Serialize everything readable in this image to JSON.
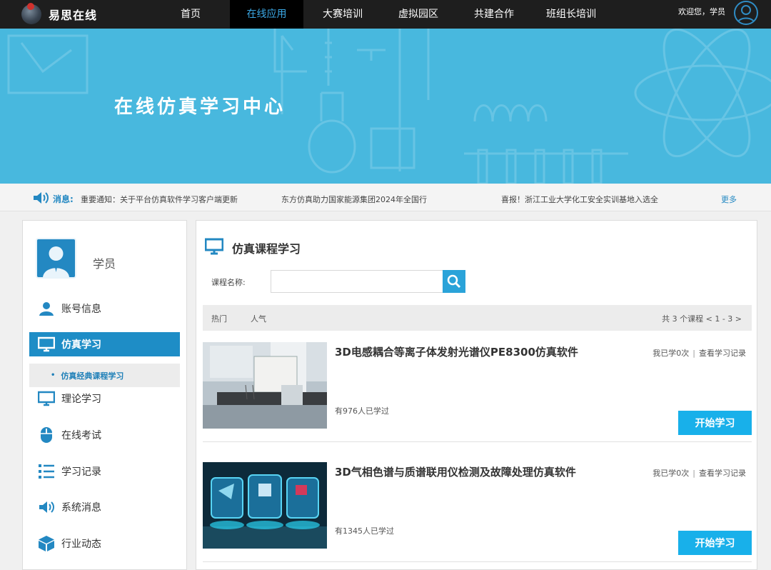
{
  "topbar": {
    "logo_text": "易思在线",
    "nav": [
      {
        "label": "首页",
        "active": false
      },
      {
        "label": "在线应用",
        "active": true
      },
      {
        "label": "大赛培训",
        "active": false
      },
      {
        "label": "虚拟园区",
        "active": false
      },
      {
        "label": "共建合作",
        "active": false
      },
      {
        "label": "班组长培训",
        "active": false
      }
    ],
    "welcome": "欢迎您，学员",
    "user_icon": "user-avatar-icon"
  },
  "banner": {
    "title": "在线仿真学习中心"
  },
  "notice": {
    "label": "消息:",
    "items": [
      "重要通知：关于平台仿真软件学习客户端更新",
      "东方仿真助力国家能源集团2024年全国行",
      "喜报！浙江工业大学化工安全实训基地入选全"
    ],
    "more": "更多"
  },
  "sidebar": {
    "user_name": "学员",
    "menu": [
      {
        "label": "账号信息",
        "icon": "user-icon",
        "active": false
      },
      {
        "label": "仿真学习",
        "icon": "monitor-icon",
        "active": true
      },
      {
        "label": "理论学习",
        "icon": "monitor-icon",
        "active": false
      },
      {
        "label": "在线考试",
        "icon": "mouse-icon",
        "active": false
      },
      {
        "label": "学习记录",
        "icon": "list-icon",
        "active": false
      },
      {
        "label": "系统消息",
        "icon": "speaker-icon",
        "active": false
      },
      {
        "label": "行业动态",
        "icon": "cube-icon",
        "active": false
      }
    ],
    "submenu": {
      "dot": "•",
      "label": "仿真经典课程学习"
    }
  },
  "main": {
    "section_title": "仿真课程学习",
    "search": {
      "label": "课程名称:",
      "value": "",
      "placeholder": ""
    },
    "filters": [
      "热门",
      "人气"
    ],
    "pager_text": "共 3 个课程 < 1 - 3 >",
    "courses": [
      {
        "title": "3D电感耦合等离子体发射光谱仪PE8300仿真软件",
        "studied": "我已学0次",
        "separator": "|",
        "record_link": "查看学习记录",
        "count": "有976人已学过",
        "button": "开始学习"
      },
      {
        "title": "3D气相色谱与质谱联用仪检测及故障处理仿真软件",
        "studied": "我已学0次",
        "separator": "|",
        "record_link": "查看学习记录",
        "count": "有1345人已学过",
        "button": "开始学习"
      }
    ]
  },
  "colors": {
    "topbar_bg": "#1e1e1e",
    "nav_active": "#3ba9e6",
    "banner_bg": "#48b8de",
    "primary": "#1e8dc6",
    "button": "#18b0ea"
  }
}
